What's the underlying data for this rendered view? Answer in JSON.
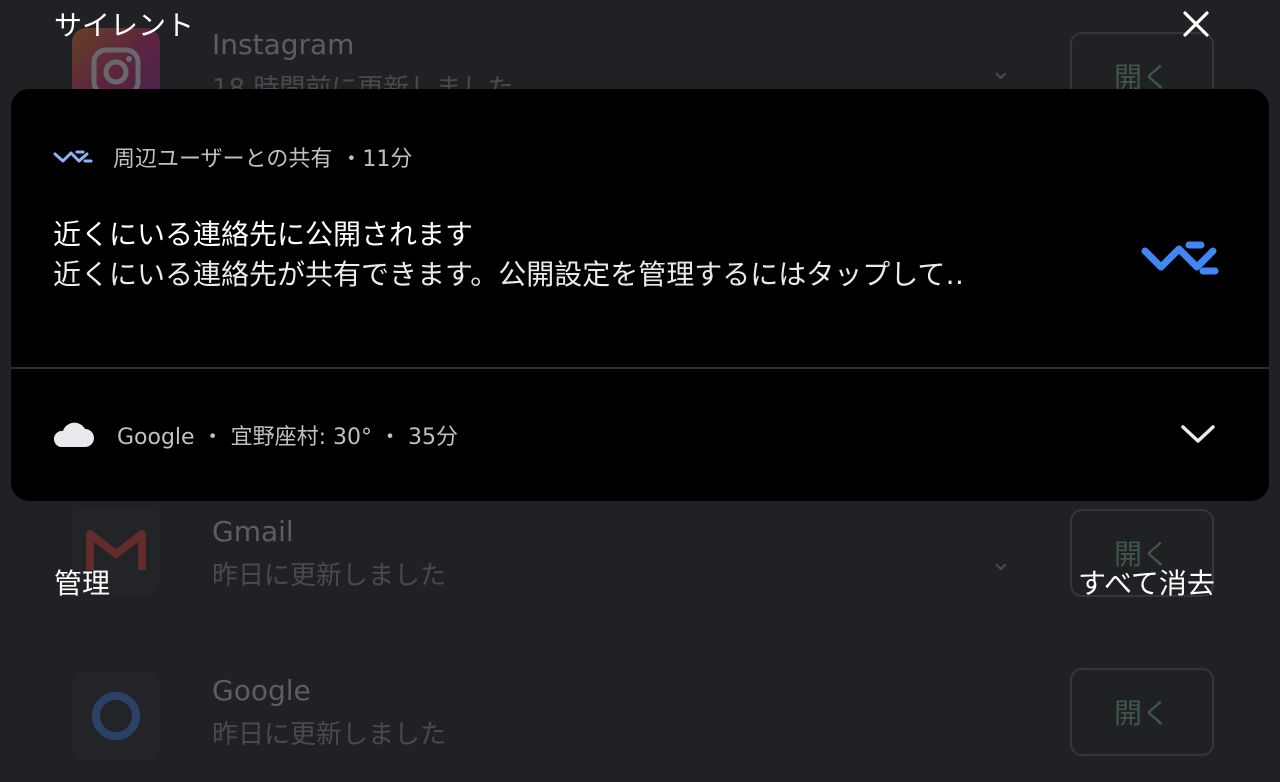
{
  "header": {
    "title": "サイレント"
  },
  "background_apps": [
    {
      "name": "Instagram",
      "subtitle": "18 時間前に更新しました",
      "open_label": "開く"
    },
    {
      "name": "Gmail",
      "subtitle": "昨日に更新しました",
      "open_label": "開く"
    },
    {
      "name": "Google",
      "subtitle": "昨日に更新しました",
      "open_label": "開く"
    }
  ],
  "notifications": [
    {
      "app": "周辺ユーザーとの共有",
      "time": "・11分",
      "title": "近くにいる連絡先に公開されます",
      "text": "近くにいる連絡先が共有できます。公開設定を管理するにはタップして‥",
      "icon": "nearby-share-icon",
      "accent_color": "#4285f4"
    },
    {
      "summary": "Google ・ 宜野座村: 30° ・ 35分",
      "icon": "cloud-icon"
    }
  ],
  "footer": {
    "manage_label": "管理",
    "clear_all_label": "すべて消去"
  },
  "colors": {
    "background": "#202124",
    "panel": "#000000",
    "accent": "#4285f4"
  }
}
